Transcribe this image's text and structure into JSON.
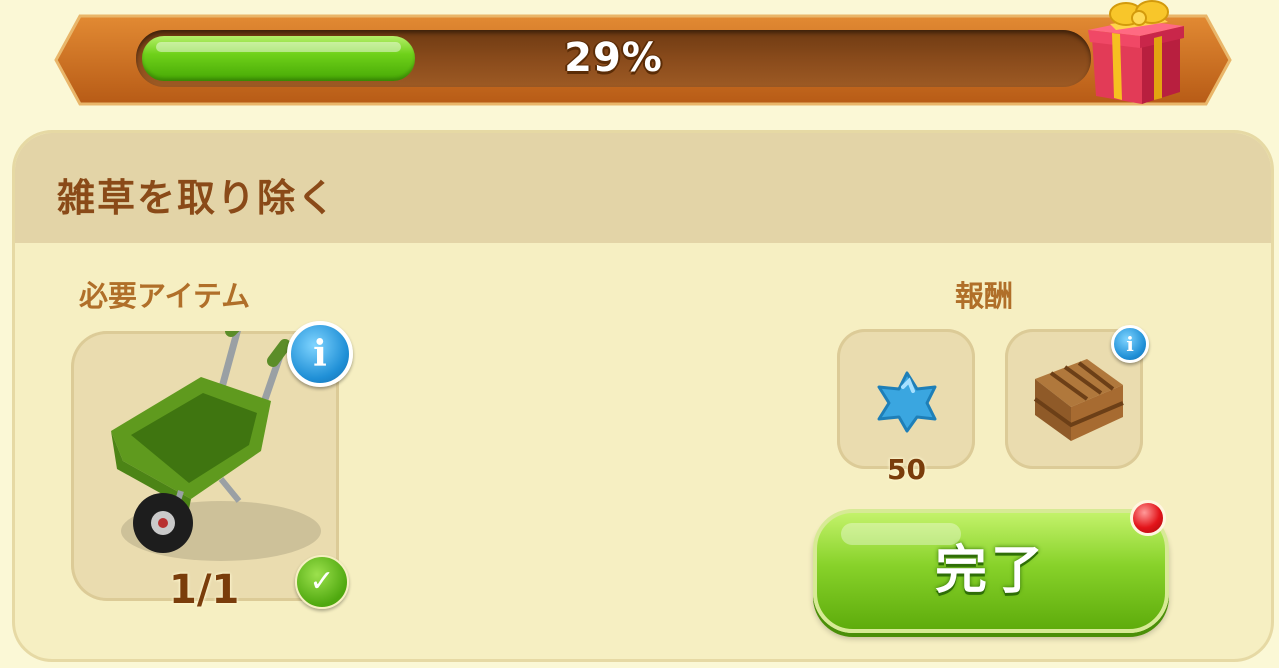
{
  "progress": {
    "percent_label": "29%",
    "value": 0.29
  },
  "task": {
    "title": "雑草を取り除く"
  },
  "required": {
    "label": "必要アイテム",
    "item_icon": "wheelbarrow-icon",
    "count": "1/1"
  },
  "rewards": {
    "label": "報酬",
    "items": [
      {
        "icon": "blue-star-icon",
        "amount": "50"
      },
      {
        "icon": "wooden-crate-icon"
      }
    ]
  },
  "complete_button": {
    "label": "完了"
  },
  "colors": {
    "accent_green": "#7ccb1f",
    "title_brown": "#8a4a18",
    "banner_orange": "#c86a20"
  }
}
